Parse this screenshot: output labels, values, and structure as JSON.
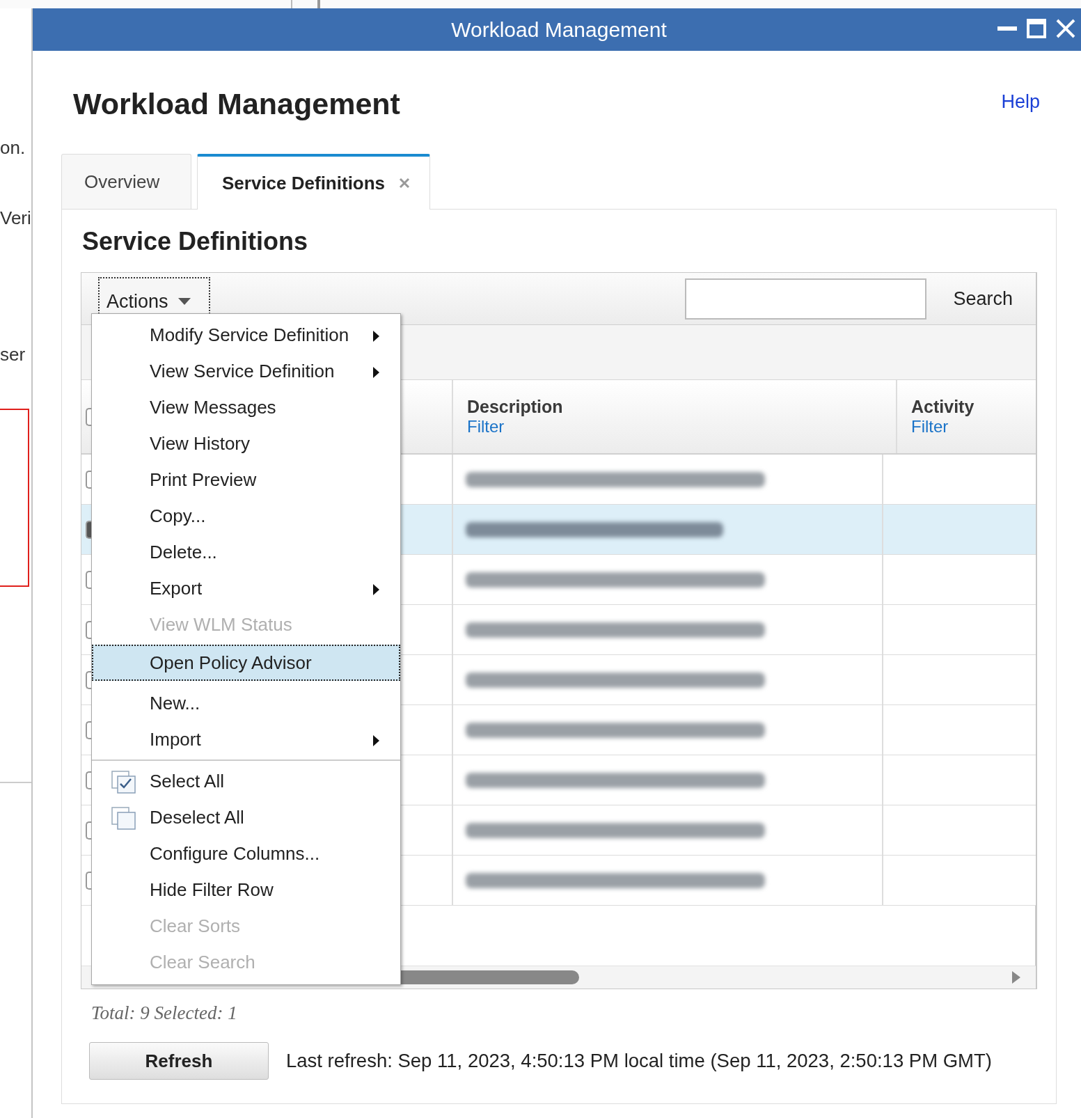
{
  "background": {
    "texts": [
      "on.",
      "Veri",
      "ser"
    ]
  },
  "window": {
    "title": "Workload Management"
  },
  "page": {
    "title": "Workload Management",
    "help_link": "Help"
  },
  "tabs": [
    {
      "label": "Overview",
      "selected": false,
      "closable": false
    },
    {
      "label": "Service Definitions",
      "selected": true,
      "closable": true
    }
  ],
  "section_title": "Service Definitions",
  "toolbar": {
    "actions_button": "Actions",
    "search_button": "Search"
  },
  "table": {
    "columns": [
      {
        "label": "Description",
        "filter": "Filter"
      },
      {
        "label": "Activity",
        "filter": "Filter"
      }
    ],
    "header_checked": false,
    "rows": [
      {
        "selected": false,
        "checked": false,
        "description": {
          "kind": "blurred"
        }
      },
      {
        "selected": true,
        "checked": true,
        "description": {
          "kind": "blurred"
        }
      },
      {
        "selected": false,
        "checked": false,
        "description": {
          "kind": "blurred"
        }
      },
      {
        "selected": false,
        "checked": false,
        "description": {
          "kind": "blurred"
        }
      },
      {
        "selected": false,
        "checked": false,
        "description": {
          "kind": "blurred"
        }
      },
      {
        "selected": false,
        "checked": false,
        "description": {
          "kind": "blurred"
        }
      },
      {
        "selected": false,
        "checked": false,
        "description": {
          "kind": "blurred"
        }
      },
      {
        "selected": false,
        "checked": false,
        "description": {
          "kind": "blurred"
        }
      },
      {
        "selected": false,
        "checked": false,
        "description": {
          "kind": "blurred"
        }
      }
    ]
  },
  "menu": {
    "items": [
      {
        "kind": "item",
        "label": "Modify Service Definition",
        "submenu": true,
        "disabled": false,
        "selected": false
      },
      {
        "kind": "item",
        "label": "View Service Definition",
        "submenu": true,
        "disabled": false,
        "selected": false
      },
      {
        "kind": "item",
        "label": "View Messages",
        "submenu": false,
        "disabled": false,
        "selected": false
      },
      {
        "kind": "item",
        "label": "View History",
        "submenu": false,
        "disabled": false,
        "selected": false
      },
      {
        "kind": "item",
        "label": "Print Preview",
        "submenu": false,
        "disabled": false,
        "selected": false
      },
      {
        "kind": "item",
        "label": "Copy...",
        "submenu": false,
        "disabled": false,
        "selected": false
      },
      {
        "kind": "item",
        "label": "Delete...",
        "submenu": false,
        "disabled": false,
        "selected": false
      },
      {
        "kind": "item",
        "label": "Export",
        "submenu": true,
        "disabled": false,
        "selected": false
      },
      {
        "kind": "item",
        "label": "View WLM Status",
        "submenu": false,
        "disabled": true,
        "selected": false
      },
      {
        "kind": "item",
        "label": "Open Policy Advisor",
        "submenu": false,
        "disabled": false,
        "selected": true
      },
      {
        "kind": "item",
        "label": "New...",
        "submenu": false,
        "disabled": false,
        "selected": false
      },
      {
        "kind": "item",
        "label": "Import",
        "submenu": true,
        "disabled": false,
        "selected": false
      },
      {
        "kind": "separator"
      },
      {
        "kind": "check",
        "label": "Select All",
        "submenu": false,
        "disabled": false,
        "selected": false,
        "checked": true
      },
      {
        "kind": "check",
        "label": "Deselect All",
        "submenu": false,
        "disabled": false,
        "selected": false,
        "checked": false
      },
      {
        "kind": "item",
        "label": "Configure Columns...",
        "submenu": false,
        "disabled": false,
        "selected": false
      },
      {
        "kind": "item",
        "label": "Hide Filter Row",
        "submenu": false,
        "disabled": false,
        "selected": false
      },
      {
        "kind": "item",
        "label": "Clear Sorts",
        "submenu": false,
        "disabled": true,
        "selected": false
      },
      {
        "kind": "item",
        "label": "Clear Search",
        "submenu": false,
        "disabled": true,
        "selected": false
      }
    ]
  },
  "footer": {
    "totals": "Total: 9 Selected: 1",
    "refresh_button": "Refresh",
    "last_refresh": "Last refresh: Sep 11, 2023, 4:50:13 PM local time (Sep 11, 2023, 2:50:13 PM GMT)"
  }
}
